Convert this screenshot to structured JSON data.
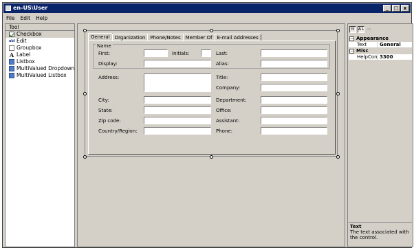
{
  "window": {
    "title": "en-US\\User",
    "minimize": "_",
    "maximize": "□",
    "close": "x"
  },
  "menu": [
    "File",
    "Edit",
    "Help"
  ],
  "toolbox": {
    "header": "Tool",
    "items": [
      {
        "label": "Checkbox",
        "icon": "checkbox-icon"
      },
      {
        "label": "Edit",
        "icon": "edit-icon"
      },
      {
        "label": "Groupbox",
        "icon": "groupbox-icon"
      },
      {
        "label": "Label",
        "icon": "label-icon"
      },
      {
        "label": "Listbox",
        "icon": "listbox-icon"
      },
      {
        "label": "MultiValued Dropdown",
        "icon": "dropdown-icon"
      },
      {
        "label": "MultiValued Listbox",
        "icon": "listbox-icon"
      }
    ],
    "edit_icon_text": "abl",
    "label_icon_text": "A"
  },
  "form": {
    "tabs": [
      "General",
      "Organization",
      "Phone/Notes",
      "Member Of",
      "E-mail Addresses"
    ],
    "active_tab": "General",
    "name_group": "Name",
    "fields": {
      "first": "First:",
      "initials": "Initials:",
      "last": "Last:",
      "display": "Display:",
      "alias": "Alias:",
      "address": "Address:",
      "title": "Title:",
      "company": "Company:",
      "city": "City:",
      "department": "Department:",
      "state": "State:",
      "office": "Office:",
      "zip": "Zip code:",
      "assistant": "Assistant:",
      "country": "Country/Region:",
      "phone": "Phone:"
    }
  },
  "properties": {
    "toolbar": {
      "categorized": "☷",
      "alphabetical": "A↓",
      "pages": "▭"
    },
    "categories": [
      {
        "name": "Appearance",
        "expander": "−",
        "rows": [
          {
            "name": "Text",
            "value": "General"
          }
        ]
      },
      {
        "name": "Misc",
        "expander": "−",
        "rows": [
          {
            "name": "HelpCont",
            "value": "3300"
          }
        ]
      }
    ],
    "description": {
      "title": "Text",
      "body": "The text associated with the control."
    }
  }
}
